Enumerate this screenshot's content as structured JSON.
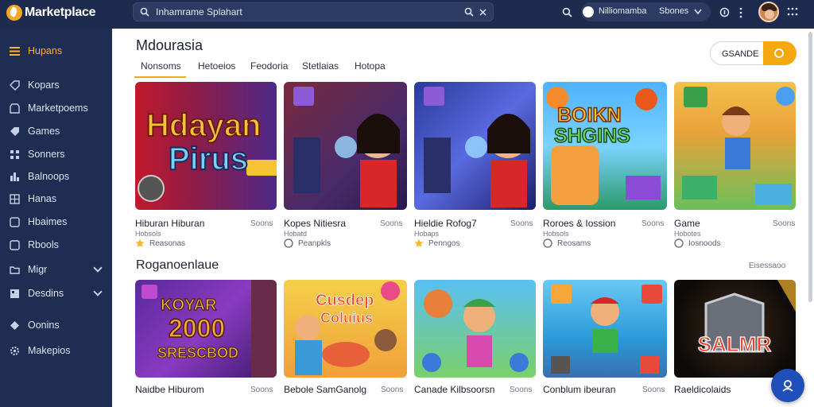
{
  "app": {
    "logo_text": "Marketplace"
  },
  "search": {
    "placeholder": "Inhamrame Splahart"
  },
  "location": {
    "label": "Nilliomamba",
    "label2": "Sbones"
  },
  "sidebar": {
    "items": [
      {
        "label": "Hupans",
        "icon": "menu-icon"
      },
      {
        "label": "Kopars",
        "icon": "tag-icon"
      },
      {
        "label": "Marketpoems",
        "icon": "store-icon"
      },
      {
        "label": "Games",
        "icon": "tag-icon"
      },
      {
        "label": "Sonners",
        "icon": "grid-icon"
      },
      {
        "label": "Balnoops",
        "icon": "chart-icon"
      },
      {
        "label": "Hanas",
        "icon": "grid-icon"
      },
      {
        "label": "Hbaimes",
        "icon": "square-icon"
      },
      {
        "label": "Rbools",
        "icon": "square-icon"
      },
      {
        "label": "Migr",
        "icon": "folder-icon"
      },
      {
        "label": "Desdins",
        "icon": "folder-icon"
      },
      {
        "label": "Oonins",
        "icon": "diamond-icon"
      },
      {
        "label": "Makepios",
        "icon": "gear-icon"
      }
    ]
  },
  "main": {
    "title": "Mdourasia",
    "tabs": [
      "Nonsoms",
      "Hetoeios",
      "Feodoria",
      "Stetlaias",
      "Hotopa"
    ],
    "sort_label": "GSANDE",
    "section_title": "Roganoenlaue",
    "section_meta": "Eisessaoo"
  },
  "cards_row1": [
    {
      "title": "Hiburan Hiburan",
      "meta": "Soons",
      "sub": "Hobsols",
      "foot": "Reasonas"
    },
    {
      "title": "Kopes Nitiesra",
      "meta": "Soons",
      "sub": "Hobatd",
      "foot": "Peanpkls"
    },
    {
      "title": "Hieldie Rofog7",
      "meta": "Soons",
      "sub": "Hobaps",
      "foot": "Penngos"
    },
    {
      "title": "Roroes & Iossion",
      "meta": "Soons",
      "sub": "Hobsols",
      "foot": "Reosams"
    },
    {
      "title": "Game",
      "meta": "Soons",
      "sub": "Hobotes",
      "foot": "Iosnoods"
    }
  ],
  "cards_row2": [
    {
      "title": "Naidbe Hiburom",
      "meta": "Soons"
    },
    {
      "title": "Bebole SamGanolg",
      "meta": "Soons"
    },
    {
      "title": "Canade Kilbsoorsn",
      "meta": "Soons"
    },
    {
      "title": "Conblum ibeuran",
      "meta": "Soons"
    },
    {
      "title": "Raeldicolaids",
      "meta": "Soons"
    }
  ],
  "art_text": {
    "card1": [
      "Hdayan",
      "Pirus"
    ],
    "card4": [
      "BOIKN",
      "SHGINS"
    ],
    "card6": [
      "KOYAR",
      "2000",
      "SRESCBOD"
    ],
    "card7": [
      "Cusdep",
      "Coluius"
    ],
    "card10": "SALMR"
  },
  "colors": {
    "accent": "#f5a80f",
    "sidebar_bg": "#1f2d52",
    "topbar_bg": "#1d2b4f"
  }
}
